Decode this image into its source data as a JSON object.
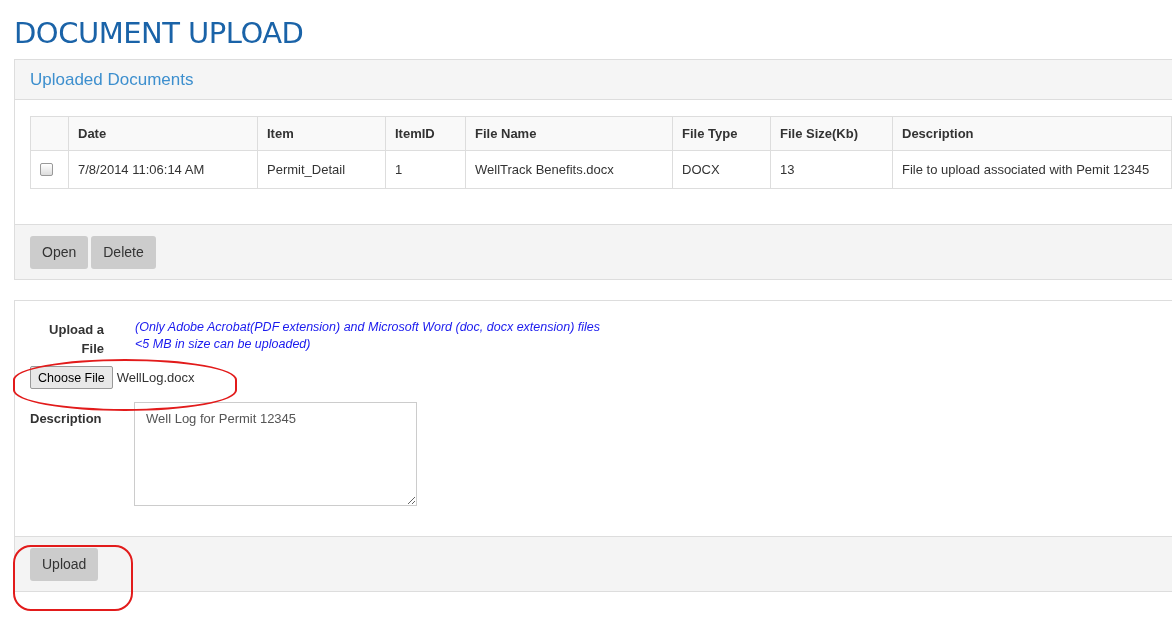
{
  "page_title": "DOCUMENT UPLOAD",
  "documents_panel": {
    "title": "Uploaded Documents",
    "table": {
      "columns": [
        "Date",
        "Item",
        "ItemID",
        "File Name",
        "File Type",
        "File Size(Kb)",
        "Description"
      ],
      "rows": [
        {
          "checked": false,
          "cells": [
            "7/8/2014 11:06:14 AM",
            "Permit_Detail",
            "1",
            "WellTrack Benefits.docx",
            "DOCX",
            "13",
            "File to upload associated with Pemit 12345"
          ]
        }
      ]
    },
    "buttons": [
      "Open",
      "Delete"
    ]
  },
  "upload_panel": {
    "file_label": "Upload a File",
    "note": "(Only Adobe Acrobat(PDF extension) and Microsoft Word (doc, docx extension) files <5 MB in size can be uploaded)",
    "choose_button": "Choose File",
    "file_name": "WellLog.docx",
    "description_label": "Description",
    "description_value": "Well Log for Permit 12345",
    "submit_button": "Upload"
  }
}
